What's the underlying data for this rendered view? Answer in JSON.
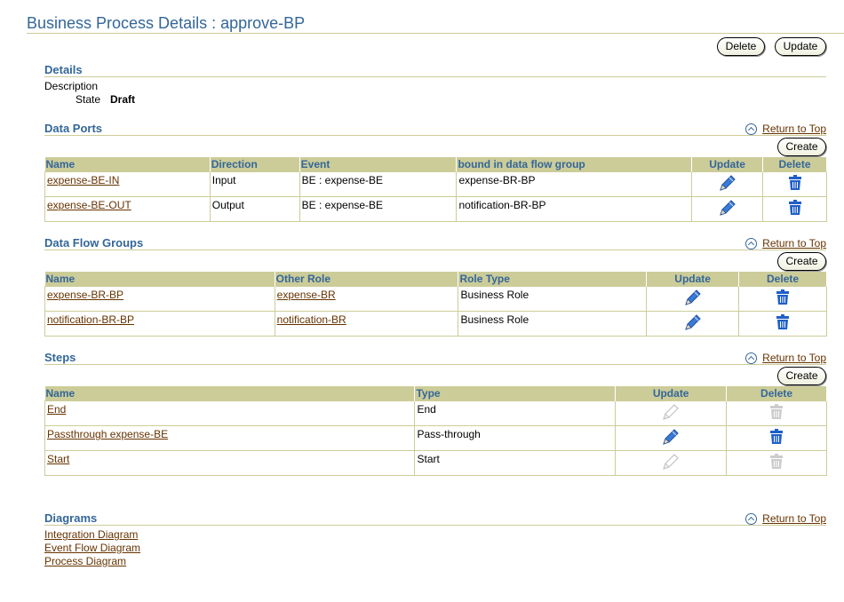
{
  "page": {
    "title": "Business Process Details : approve-BP"
  },
  "actions": {
    "delete_label": "Delete",
    "update_label": "Update"
  },
  "details": {
    "heading": "Details",
    "description_label": "Description",
    "state_label": "State",
    "state_value": "Draft"
  },
  "return_to_top": "Return to Top",
  "create_label": "Create",
  "data_ports": {
    "heading": "Data Ports",
    "columns": [
      "Name",
      "Direction",
      "Event",
      "bound in data flow group",
      "Update",
      "Delete"
    ],
    "rows": [
      {
        "name": "expense-BE-IN",
        "direction": "Input",
        "event": "BE : expense-BE",
        "group": "expense-BR-BP"
      },
      {
        "name": "expense-BE-OUT",
        "direction": "Output",
        "event": "BE : expense-BE",
        "group": "notification-BR-BP"
      }
    ]
  },
  "data_flow_groups": {
    "heading": "Data Flow Groups",
    "columns": [
      "Name",
      "Other Role",
      "Role Type",
      "Update",
      "Delete"
    ],
    "rows": [
      {
        "name": "expense-BR-BP",
        "other_role": "expense-BR",
        "role_type": "Business Role"
      },
      {
        "name": "notification-BR-BP",
        "other_role": "notification-BR",
        "role_type": "Business Role"
      }
    ]
  },
  "steps": {
    "heading": "Steps",
    "columns": [
      "Name",
      "Type",
      "Update",
      "Delete"
    ],
    "rows": [
      {
        "name": "End",
        "type": "End",
        "enabled": false
      },
      {
        "name": "Passthrough expense-BE",
        "type": "Pass-through",
        "enabled": true
      },
      {
        "name": "Start",
        "type": "Start",
        "enabled": false
      }
    ]
  },
  "diagrams": {
    "heading": "Diagrams",
    "links": [
      "Integration Diagram",
      "Event Flow Diagram",
      "Process Diagram"
    ]
  },
  "colors": {
    "accent": "#336699",
    "header_bg": "#cccc99",
    "link": "#663300",
    "icon_blue": "#1f5fc8",
    "icon_disabled": "#bbbbbb"
  },
  "icons": {
    "update": "pencil-icon",
    "delete": "trash-icon",
    "return": "up-arrow-icon"
  }
}
